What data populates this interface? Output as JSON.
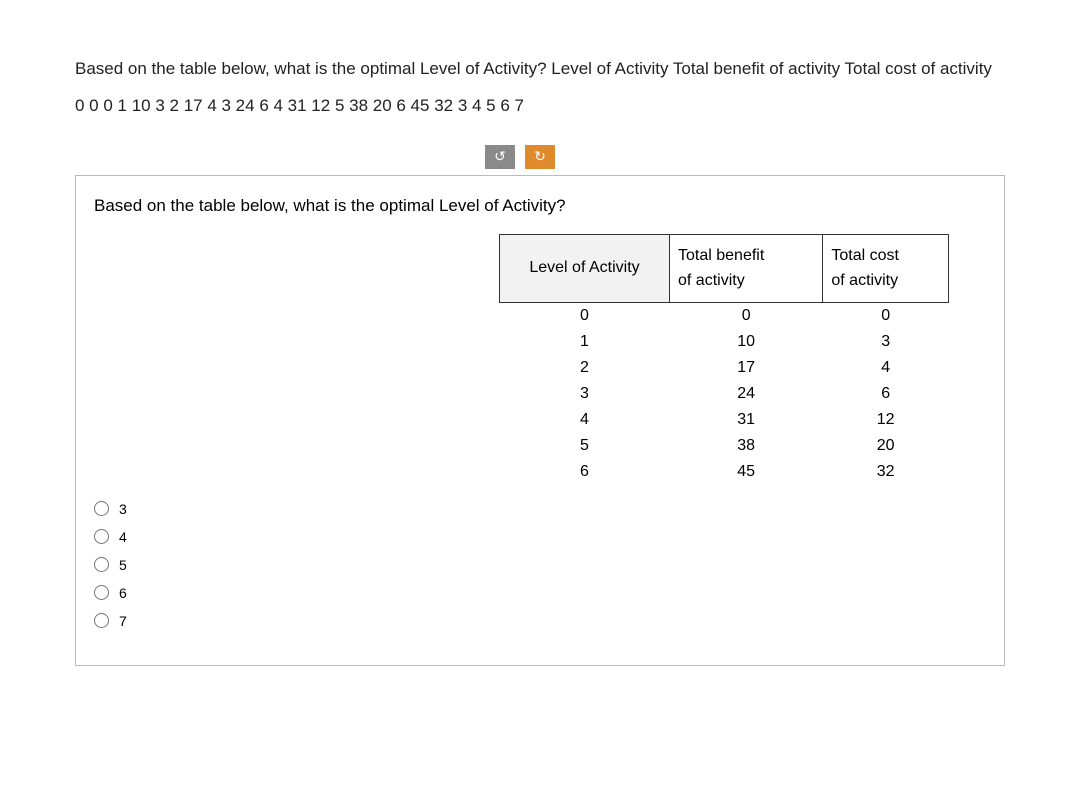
{
  "intro": "Based on the table below, what is the optimal Level of Activity? Level of Activity Total benefit of activity Total cost of activity 0 0 0 1 10 3 2 17 4 3 24 6 4 31 12 5 38 20 6 45 32 3 4 5 6 7",
  "toolbar": {
    "undo_glyph": "↺",
    "redo_glyph": "↻"
  },
  "question": {
    "title": "Based on the table below, what is the optimal Level of Activity?",
    "headers": {
      "col1": "Level of Activity",
      "col2_line1": "Total benefit",
      "col2_line2": "of activity",
      "col3_line1": "Total cost",
      "col3_line2": "of activity"
    },
    "rows": [
      {
        "level": "0",
        "benefit": "0",
        "cost": "0"
      },
      {
        "level": "1",
        "benefit": "10",
        "cost": "3"
      },
      {
        "level": "2",
        "benefit": "17",
        "cost": "4"
      },
      {
        "level": "3",
        "benefit": "24",
        "cost": "6"
      },
      {
        "level": "4",
        "benefit": "31",
        "cost": "12"
      },
      {
        "level": "5",
        "benefit": "38",
        "cost": "20"
      },
      {
        "level": "6",
        "benefit": "45",
        "cost": "32"
      }
    ],
    "options": [
      {
        "label": "3"
      },
      {
        "label": "4"
      },
      {
        "label": "5"
      },
      {
        "label": "6"
      },
      {
        "label": "7"
      }
    ]
  }
}
